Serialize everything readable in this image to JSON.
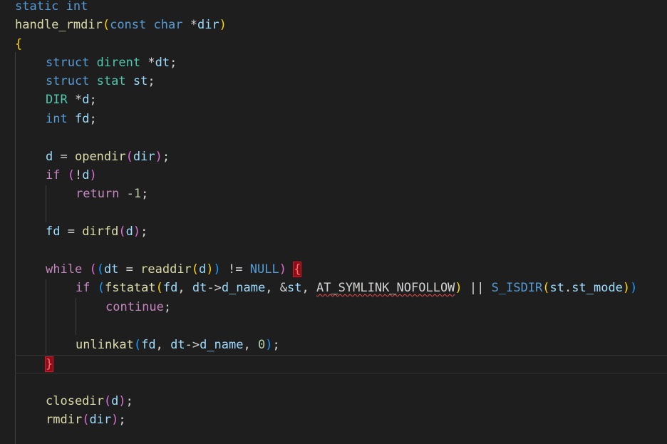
{
  "editor": {
    "language": "c",
    "theme_colors": {
      "background": "#1e1e1e",
      "keyword": "#569cd6",
      "type": "#4ec9b0",
      "function": "#dcdcaa",
      "variable": "#9cdcfe",
      "control": "#c586c0",
      "error": "#f14c4c"
    },
    "tokens": {
      "l1": {
        "static": "static",
        "int": "int"
      },
      "l2": {
        "name": "handle_rmdir",
        "lp": "(",
        "const": "const",
        "char": "char",
        "star": " *",
        "dir": "dir",
        "rp": ")"
      },
      "l3": {
        "lb": "{"
      },
      "l4": {
        "struct": "struct",
        "dirent": "dirent",
        "star": " *",
        "dt": "dt",
        "semi": ";"
      },
      "l5": {
        "struct": "struct",
        "stat": "stat",
        "st": "st",
        "semi": ";"
      },
      "l6": {
        "DIR": "DIR",
        "star": " *",
        "d": "d",
        "semi": ";"
      },
      "l7": {
        "int": "int",
        "fd": "fd",
        "semi": ";"
      },
      "l9": {
        "d": "d",
        "eq": " = ",
        "fn": "opendir",
        "lp": "(",
        "dir": "dir",
        "rp": ")",
        "semi": ";"
      },
      "l10": {
        "if": "if",
        "lp": "(",
        "not": "!",
        "d": "d",
        "rp": ")"
      },
      "l11": {
        "ret": "return",
        "neg": " -",
        "one": "1",
        "semi": ";"
      },
      "l13": {
        "fd": "fd",
        "eq": " = ",
        "fn": "dirfd",
        "lp": "(",
        "d": "d",
        "rp": ")",
        "semi": ";"
      },
      "l15": {
        "while": "while",
        "lp1": "(",
        "lp2": "(",
        "dt": "dt",
        "eq": " = ",
        "fn": "readdir",
        "lp3": "(",
        "d": "d",
        "rp3": ")",
        "rp2": ")",
        "neq": " != ",
        "null": "NULL",
        "rp1": ")",
        "lb": "{"
      },
      "l16": {
        "if": "if",
        "lp1": "(",
        "fn": "fstatat",
        "lp2": "(",
        "fd": "fd",
        "c1": ", ",
        "dt": "dt",
        "arrow": "->",
        "dname": "d_name",
        "c2": ", ",
        "amp": "&",
        "st": "st",
        "c3": ", ",
        "macro": "AT_SYMLINK_NOFOLLOW",
        "rp2": ")",
        "or": " || ",
        "isdir": "S_ISDIR",
        "lp3": "(",
        "st2": "st",
        "dot": ".",
        "mode": "st_mode",
        "rp3": ")",
        "rp1": ")"
      },
      "l17": {
        "cont": "continue",
        "semi": ";"
      },
      "l19": {
        "fn": "unlinkat",
        "lp": "(",
        "fd": "fd",
        "c1": ", ",
        "dt": "dt",
        "arrow": "->",
        "dname": "d_name",
        "c2": ", ",
        "zero": "0",
        "rp": ")",
        "semi": ";"
      },
      "l20": {
        "rb": "}"
      },
      "l22": {
        "fn": "closedir",
        "lp": "(",
        "d": "d",
        "rp": ")",
        "semi": ";"
      },
      "l23": {
        "fn": "rmdir",
        "lp": "(",
        "dir": "dir",
        "rp": ")",
        "semi": ";"
      }
    }
  }
}
